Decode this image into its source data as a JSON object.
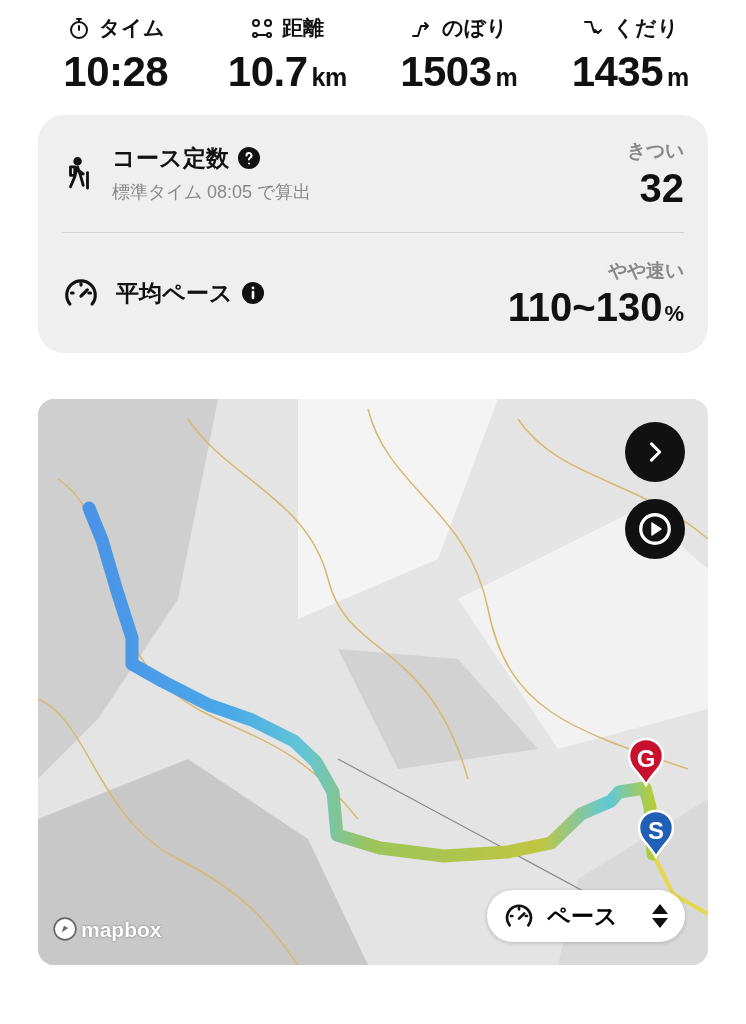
{
  "stats": [
    {
      "kind": "time",
      "label": "タイム",
      "value": "10:28"
    },
    {
      "kind": "distance",
      "label": "距離",
      "value": "10.7",
      "unit": "km"
    },
    {
      "kind": "ascent",
      "label": "のぼり",
      "value": "1503",
      "unit": "m"
    },
    {
      "kind": "descent",
      "label": "くだり",
      "value": "1435",
      "unit": "m"
    }
  ],
  "summary": {
    "rows": [
      {
        "kind": "course",
        "title": "コース定数",
        "subtitle": "標準タイム 08:05 で算出",
        "rating": "きつい",
        "value": "32"
      },
      {
        "kind": "pace",
        "title": "平均ペース",
        "rating": "やや速い",
        "value": "110~130",
        "unit": "%"
      }
    ]
  },
  "map": {
    "kind": "picture",
    "markers": [
      {
        "kind": "goal",
        "letter": "G",
        "color": "#c8102e"
      },
      {
        "kind": "start",
        "letter": "S",
        "color": "#1f5fb5"
      }
    ],
    "attribution": "mapbox",
    "mode_selector": {
      "label": "ペース"
    }
  }
}
